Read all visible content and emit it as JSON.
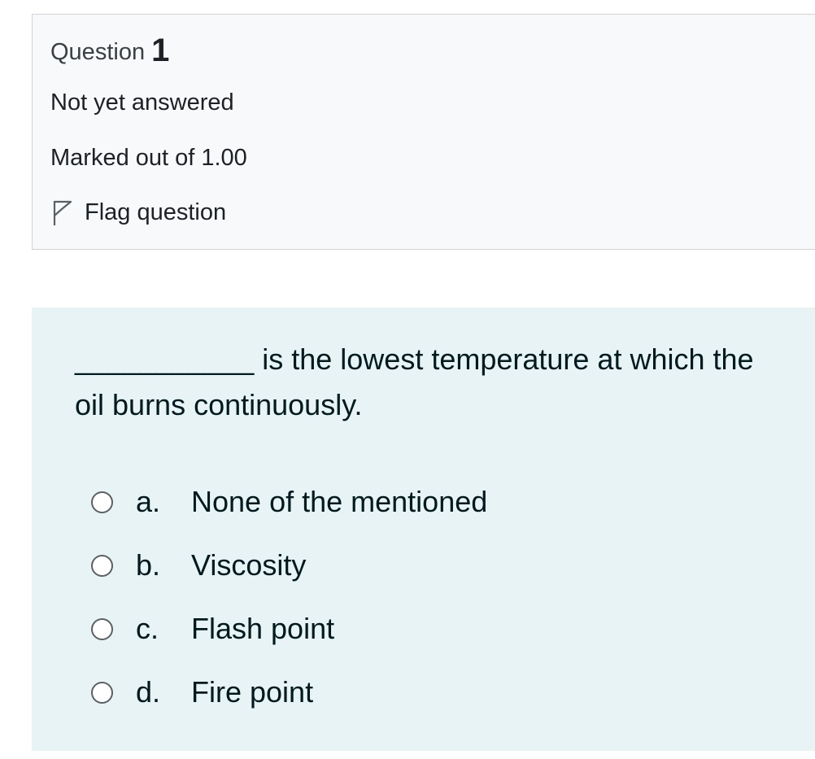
{
  "info": {
    "question_label": "Question",
    "question_number": "1",
    "state": "Not yet answered",
    "grade": "Marked out of 1.00",
    "flag_label": "Flag question"
  },
  "question": {
    "text": "___________ is the lowest temperature at which the oil burns continuously.",
    "options": [
      {
        "letter": "a.",
        "label": "None of the mentioned"
      },
      {
        "letter": "b.",
        "label": "Viscosity"
      },
      {
        "letter": "c.",
        "label": "Flash point"
      },
      {
        "letter": "d.",
        "label": "Fire point"
      }
    ]
  },
  "icons": {
    "flag": "flag-icon",
    "radio": "radio-unselected-icon"
  },
  "colors": {
    "info_background": "#f8f9fa",
    "info_border": "#ced4da",
    "content_background": "#e7f3f5",
    "text": "#001a1e"
  }
}
